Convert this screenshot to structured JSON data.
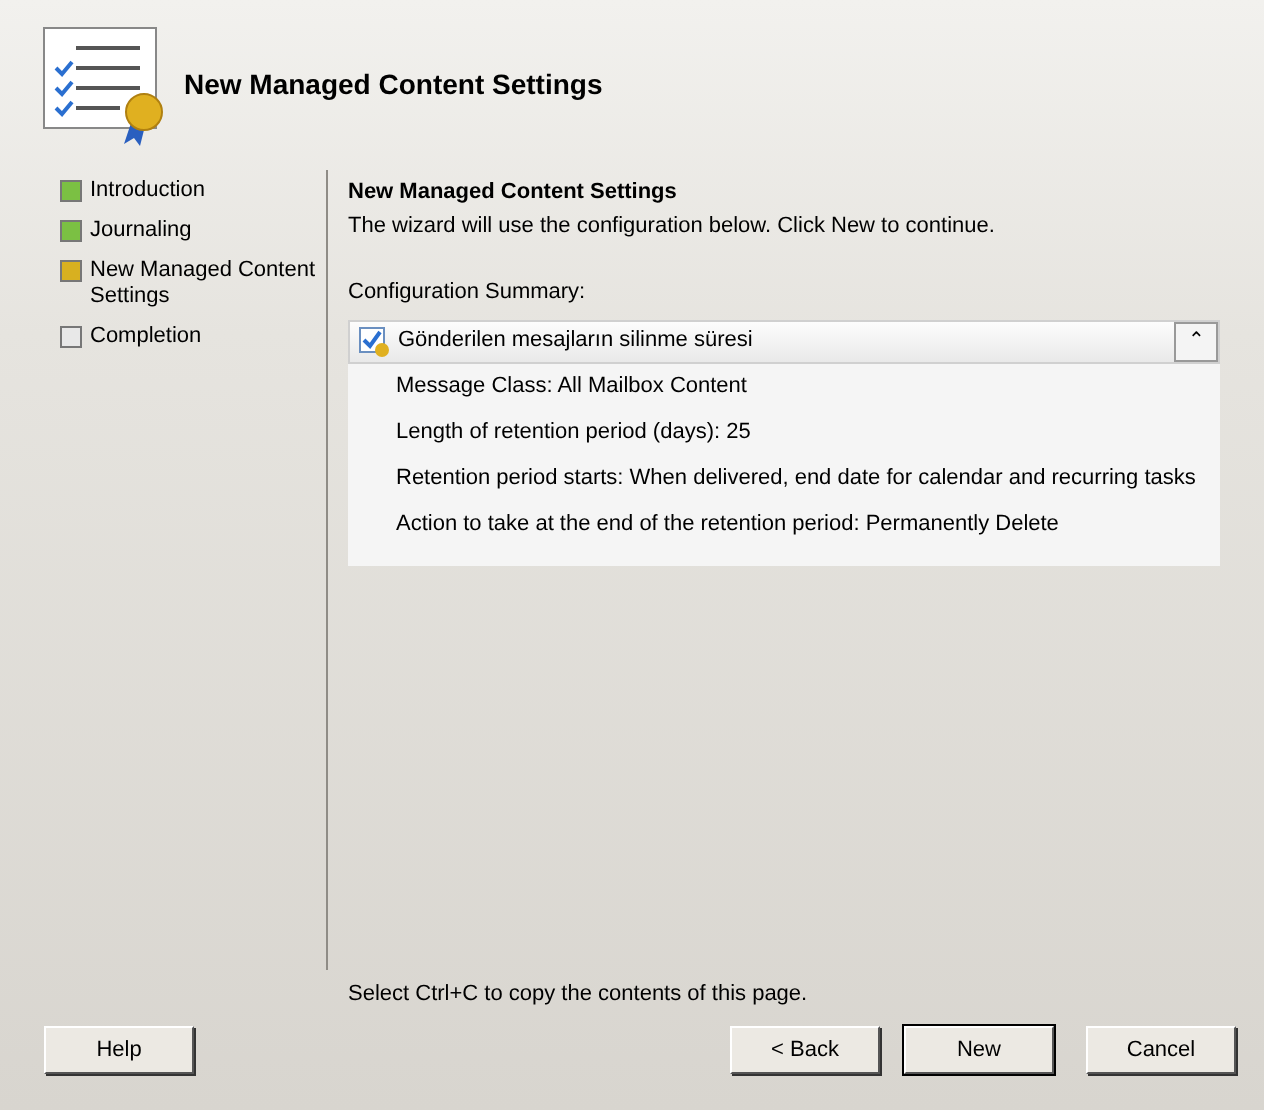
{
  "header": {
    "title": "New Managed Content Settings"
  },
  "steps": [
    {
      "label": "Introduction",
      "kind": "completed"
    },
    {
      "label": "Journaling",
      "kind": "completed"
    },
    {
      "label": "New Managed Content Settings",
      "kind": "current"
    },
    {
      "label": "Completion",
      "kind": "pending"
    }
  ],
  "content": {
    "heading": "New Managed Content Settings",
    "intro": "The wizard will use the configuration below.  Click New to continue.",
    "summary_label": "Configuration Summary:",
    "summary": {
      "title": "Gönderilen mesajların silinme süresi",
      "expanded": true,
      "collapse_glyph": "⌃",
      "lines": [
        "Message Class: All Mailbox Content",
        "Length of retention period (days): 25",
        "Retention period starts: When delivered, end date for calendar and recurring tasks",
        "Action to take at the end of the retention period: Permanently Delete"
      ]
    },
    "copy_hint": "Select Ctrl+C to copy the contents of this page."
  },
  "left_buttons": [
    {
      "label": "Help",
      "default": false
    }
  ],
  "right_buttons": [
    {
      "label": "< Back",
      "default": false
    },
    {
      "label": "New",
      "default": true
    },
    {
      "label": "Cancel",
      "default": false
    }
  ]
}
